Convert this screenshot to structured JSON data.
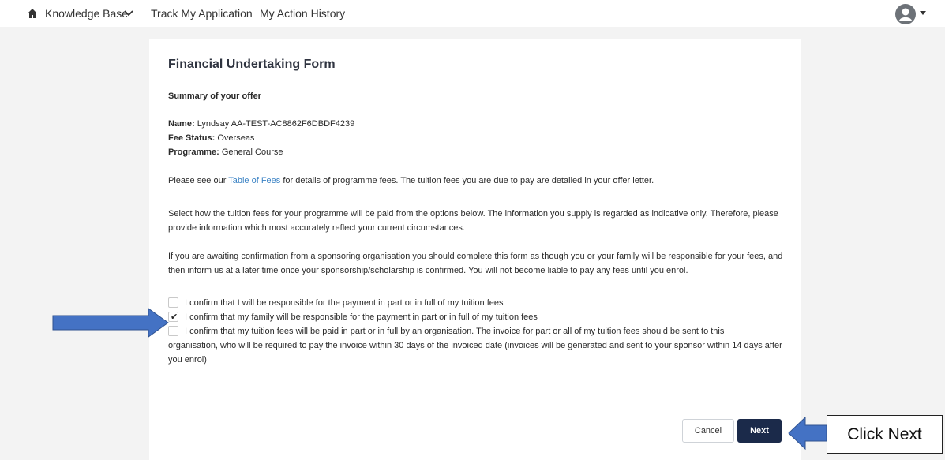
{
  "nav": {
    "home_icon": "home-icon",
    "knowledge_base": "Knowledge Base",
    "track_application": "Track My Application",
    "action_history": "My Action History",
    "avatar_icon": "user-avatar-icon"
  },
  "form": {
    "title": "Financial Undertaking Form",
    "summary_heading": "Summary of your offer",
    "name_label": "Name:",
    "name_value": "Lyndsay AA-TEST-AC8862F6DBDF4239",
    "fee_status_label": "Fee Status:",
    "fee_status_value": "Overseas",
    "programme_label": "Programme:",
    "programme_value": "General Course",
    "fees_text_before": "Please see our ",
    "fees_link": "Table of Fees",
    "fees_text_after": " for details of programme fees. The tuition fees you are due to pay are detailed in your offer letter.",
    "select_text": "Select how the tuition fees for your programme will be paid from the options below. The information you supply is regarded as indicative only. Therefore, please provide information which most accurately reflect your current circumstances.",
    "awaiting_text": "If you are awaiting confirmation from a sponsoring organisation you should complete this form as though you or your family will be responsible for your fees, and then inform us at a later time once your sponsorship/scholarship is confirmed. You will not become liable to pay any fees until you enrol.",
    "options": [
      {
        "label": "I confirm that I will be responsible for the payment in part or in full of my tuition fees",
        "checked": false
      },
      {
        "label": "I confirm that my family will be responsible for the payment in part or in full of my tuition fees",
        "checked": true
      },
      {
        "label": "I confirm that my tuition fees will be paid in part or in full by an organisation. The invoice for part or all of my tuition fees should be sent to this",
        "label_continued": "organisation, who will be required to pay the invoice within 30 days of the invoiced date (invoices will be generated and sent to your sponsor within 14 days after you enrol)",
        "checked": false
      }
    ],
    "check_mark": "✔",
    "cancel_label": "Cancel",
    "next_label": "Next"
  },
  "annotation": {
    "callout_text": "Click Next",
    "arrow_color": "#4472c4"
  },
  "colors": {
    "next_button": "#1b2a4a",
    "link": "#3a82c4",
    "page_background": "#f3f3f3"
  }
}
